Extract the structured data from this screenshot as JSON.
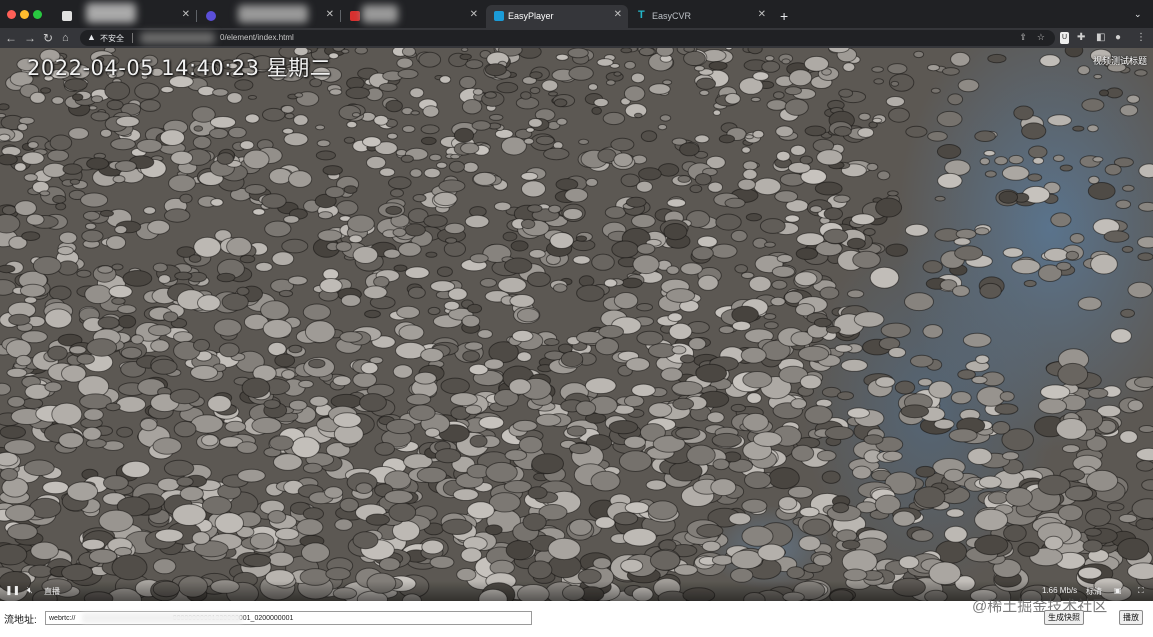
{
  "browser": {
    "tabs": [
      {
        "title": "",
        "favicon": "generic-icon",
        "active": false
      },
      {
        "title": "",
        "favicon": "circle-icon",
        "active": false
      },
      {
        "title": "",
        "favicon": "red-square-icon",
        "active": false
      },
      {
        "title": "EasyPlayer",
        "favicon": "play-icon",
        "active": true
      },
      {
        "title": "EasyCVR",
        "favicon": "t-logo-icon",
        "active": false
      }
    ],
    "new_tab_label": "+",
    "security_label": "不安全",
    "url_visible": "0/element/index.html"
  },
  "player": {
    "timestamp": "2022-04-05 14:40:23 星期二",
    "overlay_title": "视频测试标题",
    "live_label": "直播",
    "bitrate": "1.66 Mb/s",
    "quality_label": "标清"
  },
  "controls": {
    "stream_label": "流地址:",
    "stream_value": "webrtc://                                                  00000000001320000001_0200000001",
    "snapshot_button": "生成快照",
    "play_button": "播放"
  },
  "watermark": "@稀土掘金技术社区",
  "colors": {
    "tab_bar": "#202124",
    "toolbar": "#35363a",
    "accent_blue": "#1a73e8"
  }
}
